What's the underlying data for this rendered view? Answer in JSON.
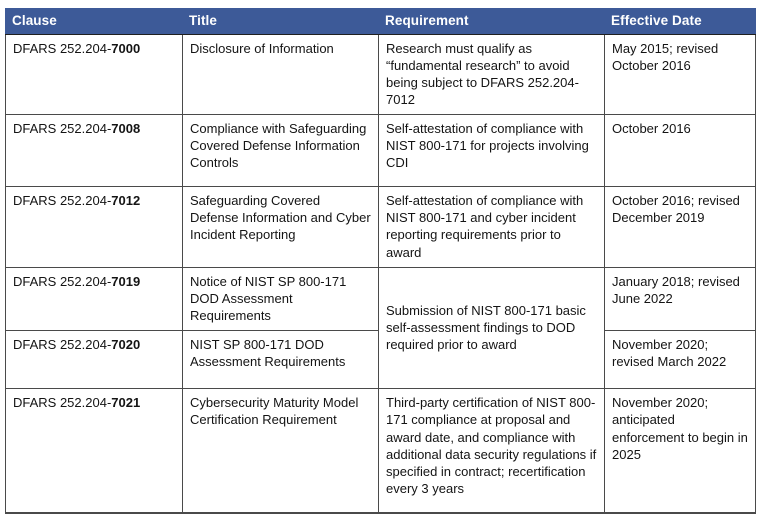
{
  "table": {
    "columns": [
      {
        "key": "clause",
        "label": "Clause"
      },
      {
        "key": "title",
        "label": "Title"
      },
      {
        "key": "requirement",
        "label": "Requirement"
      },
      {
        "key": "effective_date",
        "label": "Effective Date"
      }
    ],
    "header_background": "#3d5a98",
    "header_text_color": "#ffffff",
    "border_color": "#4a4a4a",
    "rows": [
      {
        "clause_prefix": "DFARS 252.204-",
        "clause_number": "7000",
        "title": "Disclosure of Information",
        "requirement": "Research must qualify as “fundamental research” to avoid being subject to DFARS 252.204-7012",
        "effective_date": "May 2015; revised October 2016"
      },
      {
        "clause_prefix": "DFARS 252.204-",
        "clause_number": "7008",
        "title": "Compliance with Safeguarding Covered Defense Information Controls",
        "requirement": "Self-attestation of compliance with NIST 800-171 for projects involving CDI",
        "effective_date": "October 2016"
      },
      {
        "clause_prefix": "DFARS 252.204-",
        "clause_number": "7012",
        "title": "Safeguarding Covered Defense Information and Cyber Incident Reporting",
        "requirement": "Self-attestation of compliance with NIST 800-171 and cyber incident reporting requirements prior to award",
        "effective_date": "October 2016; revised December 2019"
      },
      {
        "clause_prefix": "DFARS 252.204-",
        "clause_number": "7019",
        "title": "Notice of NIST SP 800-171 DOD Assessment Requirements",
        "requirement": "Submission of NIST 800-171 basic self-assessment findings to DOD required prior to award",
        "requirement_rowspan": 2,
        "effective_date": "January 2018; revised June 2022"
      },
      {
        "clause_prefix": "DFARS 252.204-",
        "clause_number": "7020",
        "title": "NIST SP 800-171 DOD Assessment Requirements",
        "requirement": null,
        "effective_date": "November 2020; revised March 2022"
      },
      {
        "clause_prefix": "DFARS 252.204-",
        "clause_number": "7021",
        "title": "Cybersecurity Maturity Model Certification Requirement",
        "requirement": "Third-party certification of NIST 800-171 compliance at proposal and award date, and compliance with additional data security regulations if specified in contract; recertification every 3 years",
        "effective_date": "November 2020; anticipated enforcement to begin in 2025"
      }
    ]
  }
}
